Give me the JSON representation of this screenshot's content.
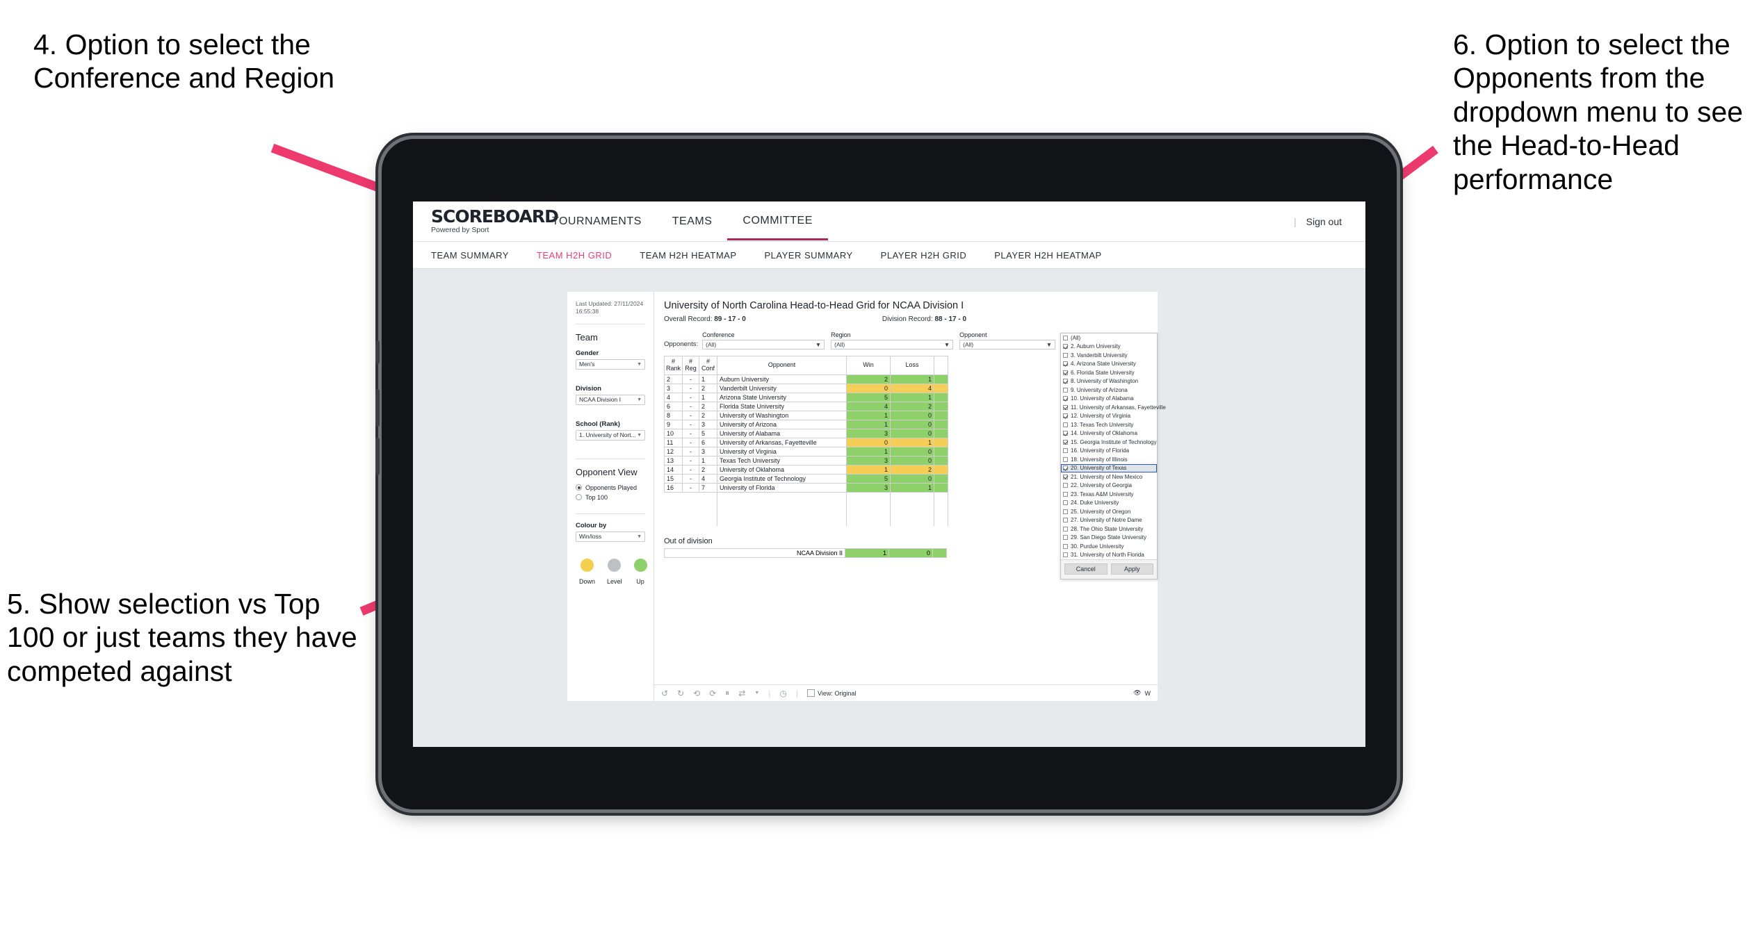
{
  "annotations": [
    {
      "id": "anno4",
      "text": "4. Option to select the Conference and Region"
    },
    {
      "id": "anno5",
      "text": "5. Show selection vs Top 100 or just teams they have competed against"
    },
    {
      "id": "anno6",
      "text": "6. Option to select the Opponents from the dropdown menu to see the Head-to-Head performance"
    }
  ],
  "brand": {
    "line1": "SCOREBOARD",
    "line2": "Powered by Sport"
  },
  "topnav": {
    "items": [
      {
        "label": "TOURNAMENTS",
        "active": false
      },
      {
        "label": "TEAMS",
        "active": false
      },
      {
        "label": "COMMITTEE",
        "active": true
      }
    ],
    "divider": "|",
    "signout": "Sign out"
  },
  "subnav": {
    "items": [
      {
        "label": "TEAM SUMMARY",
        "active": false
      },
      {
        "label": "TEAM H2H GRID",
        "active": true
      },
      {
        "label": "TEAM H2H HEATMAP",
        "active": false
      },
      {
        "label": "PLAYER SUMMARY",
        "active": false
      },
      {
        "label": "PLAYER H2H GRID",
        "active": false
      },
      {
        "label": "PLAYER H2H HEATMAP",
        "active": false
      }
    ]
  },
  "sidebar": {
    "last_updated": "Last Updated: 27/11/2024 16:55:38",
    "team_heading": "Team",
    "gender_label": "Gender",
    "gender_value": "Men's",
    "division_label": "Division",
    "division_value": "NCAA Division I",
    "school_label": "School (Rank)",
    "school_value": "1. University of Nort...",
    "opponent_view_heading": "Opponent View",
    "opponent_view_options": [
      {
        "label": "Opponents Played",
        "selected": true
      },
      {
        "label": "Top 100",
        "selected": false
      }
    ],
    "colour_by_label": "Colour by",
    "colour_by_value": "Win/loss",
    "legend": [
      {
        "label": "Down",
        "color": "#f2cf4e"
      },
      {
        "label": "Level",
        "color": "#bdc1c6"
      },
      {
        "label": "Up",
        "color": "#8ed06a"
      }
    ]
  },
  "main": {
    "title": "University of North Carolina Head-to-Head Grid for NCAA Division I",
    "overall_record_label": "Overall Record:",
    "overall_record_value": "89 - 17 - 0",
    "division_record_label": "Division Record:",
    "division_record_value": "88 - 17 - 0",
    "opponents_label": "Opponents:",
    "filters": [
      {
        "label": "Conference",
        "value": "(All)"
      },
      {
        "label": "Region",
        "value": "(All)"
      },
      {
        "label": "Opponent",
        "value": "(All)"
      }
    ],
    "out_of_division_heading": "Out of division",
    "out_of_division_row": {
      "name": "NCAA Division II",
      "win": "1",
      "loss": "0",
      "color": "win"
    }
  },
  "chart_data": {
    "type": "table",
    "title": "University of North Carolina Head-to-Head Grid for NCAA Division I",
    "columns": [
      "# Rank",
      "# Reg",
      "# Conf",
      "Opponent",
      "Win",
      "Loss"
    ],
    "column_headers_wrapped": [
      [
        "#",
        "Rank"
      ],
      [
        "#",
        "Reg"
      ],
      [
        "#",
        "Conf"
      ],
      [
        "Opponent"
      ],
      [
        "Win"
      ],
      [
        "Loss"
      ]
    ],
    "rows": [
      {
        "rank": "2",
        "reg": "-",
        "conf": "1",
        "opponent": "Auburn University",
        "win": "2",
        "loss": "1",
        "color": "win"
      },
      {
        "rank": "3",
        "reg": "-",
        "conf": "2",
        "opponent": "Vanderbilt University",
        "win": "0",
        "loss": "4",
        "color": "loss"
      },
      {
        "rank": "4",
        "reg": "-",
        "conf": "1",
        "opponent": "Arizona State University",
        "win": "5",
        "loss": "1",
        "color": "win"
      },
      {
        "rank": "6",
        "reg": "-",
        "conf": "2",
        "opponent": "Florida State University",
        "win": "4",
        "loss": "2",
        "color": "win"
      },
      {
        "rank": "8",
        "reg": "-",
        "conf": "2",
        "opponent": "University of Washington",
        "win": "1",
        "loss": "0",
        "color": "win"
      },
      {
        "rank": "9",
        "reg": "-",
        "conf": "3",
        "opponent": "University of Arizona",
        "win": "1",
        "loss": "0",
        "color": "win"
      },
      {
        "rank": "10",
        "reg": "-",
        "conf": "5",
        "opponent": "University of Alabama",
        "win": "3",
        "loss": "0",
        "color": "win"
      },
      {
        "rank": "11",
        "reg": "-",
        "conf": "6",
        "opponent": "University of Arkansas, Fayetteville",
        "win": "0",
        "loss": "1",
        "color": "loss"
      },
      {
        "rank": "12",
        "reg": "-",
        "conf": "3",
        "opponent": "University of Virginia",
        "win": "1",
        "loss": "0",
        "color": "win"
      },
      {
        "rank": "13",
        "reg": "-",
        "conf": "1",
        "opponent": "Texas Tech University",
        "win": "3",
        "loss": "0",
        "color": "win"
      },
      {
        "rank": "14",
        "reg": "-",
        "conf": "2",
        "opponent": "University of Oklahoma",
        "win": "1",
        "loss": "2",
        "color": "loss"
      },
      {
        "rank": "15",
        "reg": "-",
        "conf": "4",
        "opponent": "Georgia Institute of Technology",
        "win": "5",
        "loss": "0",
        "color": "win"
      },
      {
        "rank": "16",
        "reg": "-",
        "conf": "7",
        "opponent": "University of Florida",
        "win": "3",
        "loss": "1",
        "color": "win"
      }
    ],
    "out_of_division": [
      {
        "name": "NCAA Division II",
        "win": "1",
        "loss": "0"
      }
    ],
    "legend": [
      {
        "label": "Down",
        "color": "#f2cf4e"
      },
      {
        "label": "Level",
        "color": "#bdc1c6"
      },
      {
        "label": "Up",
        "color": "#8ed06a"
      }
    ]
  },
  "opponent_dropdown": {
    "items": [
      {
        "label": "(All)",
        "checked": false,
        "highlighted": false
      },
      {
        "label": "2. Auburn University",
        "checked": true,
        "highlighted": false
      },
      {
        "label": "3. Vanderbilt University",
        "checked": false,
        "highlighted": false
      },
      {
        "label": "4. Arizona State University",
        "checked": true,
        "highlighted": false
      },
      {
        "label": "6. Florida State University",
        "checked": true,
        "highlighted": false
      },
      {
        "label": "8. University of Washington",
        "checked": true,
        "highlighted": false
      },
      {
        "label": "9. University of Arizona",
        "checked": false,
        "highlighted": false
      },
      {
        "label": "10. University of Alabama",
        "checked": true,
        "highlighted": false
      },
      {
        "label": "11. University of Arkansas, Fayetteville",
        "checked": true,
        "highlighted": false
      },
      {
        "label": "12. University of Virginia",
        "checked": true,
        "highlighted": false
      },
      {
        "label": "13. Texas Tech University",
        "checked": false,
        "highlighted": false
      },
      {
        "label": "14. University of Oklahoma",
        "checked": true,
        "highlighted": false
      },
      {
        "label": "15. Georgia Institute of Technology",
        "checked": true,
        "highlighted": false
      },
      {
        "label": "16. University of Florida",
        "checked": false,
        "highlighted": false
      },
      {
        "label": "18. University of Illinois",
        "checked": false,
        "highlighted": false
      },
      {
        "label": "20. University of Texas",
        "checked": true,
        "highlighted": true
      },
      {
        "label": "21. University of New Mexico",
        "checked": true,
        "highlighted": false
      },
      {
        "label": "22. University of Georgia",
        "checked": false,
        "highlighted": false
      },
      {
        "label": "23. Texas A&M University",
        "checked": false,
        "highlighted": false
      },
      {
        "label": "24. Duke University",
        "checked": false,
        "highlighted": false
      },
      {
        "label": "25. University of Oregon",
        "checked": false,
        "highlighted": false
      },
      {
        "label": "27. University of Notre Dame",
        "checked": false,
        "highlighted": false
      },
      {
        "label": "28. The Ohio State University",
        "checked": false,
        "highlighted": false
      },
      {
        "label": "29. San Diego State University",
        "checked": false,
        "highlighted": false
      },
      {
        "label": "30. Purdue University",
        "checked": false,
        "highlighted": false
      },
      {
        "label": "31. University of North Florida",
        "checked": false,
        "highlighted": false
      }
    ],
    "cancel_label": "Cancel",
    "apply_label": "Apply"
  },
  "toolbar": {
    "view_label": "View: Original",
    "watch_label": "W"
  },
  "colors": {
    "accent": "#e8416f",
    "nav_underline": "#b4265a",
    "win": "#8ed06a",
    "loss": "#f5cf55",
    "level": "#bdc1c6",
    "arrow": "#ec3a6e"
  }
}
